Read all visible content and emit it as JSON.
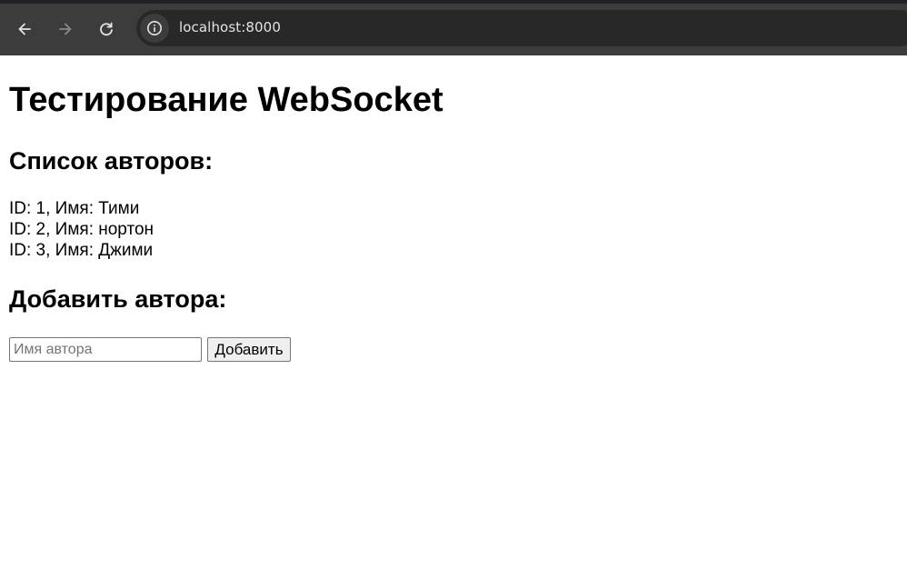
{
  "browser": {
    "url": "localhost:8000"
  },
  "page": {
    "title": "Тестирование WebSocket",
    "authors_heading": "Список авторов:",
    "authors": [
      "ID: 1, Имя: Тими",
      "ID: 2, Имя: нортон",
      "ID: 3, Имя: Джими"
    ],
    "add_heading": "Добавить автора:",
    "form": {
      "name_placeholder": "Имя автора",
      "name_value": "",
      "add_button_label": "Добавить"
    }
  },
  "icons": {
    "back": "arrow-left-icon",
    "forward": "arrow-right-icon",
    "reload": "reload-icon",
    "site_info": "info-icon"
  },
  "colors": {
    "toolbar_bg": "#3c3c3c",
    "omnibox_bg": "#282828",
    "url_text": "#e3e3e3",
    "page_bg": "#ffffff"
  }
}
